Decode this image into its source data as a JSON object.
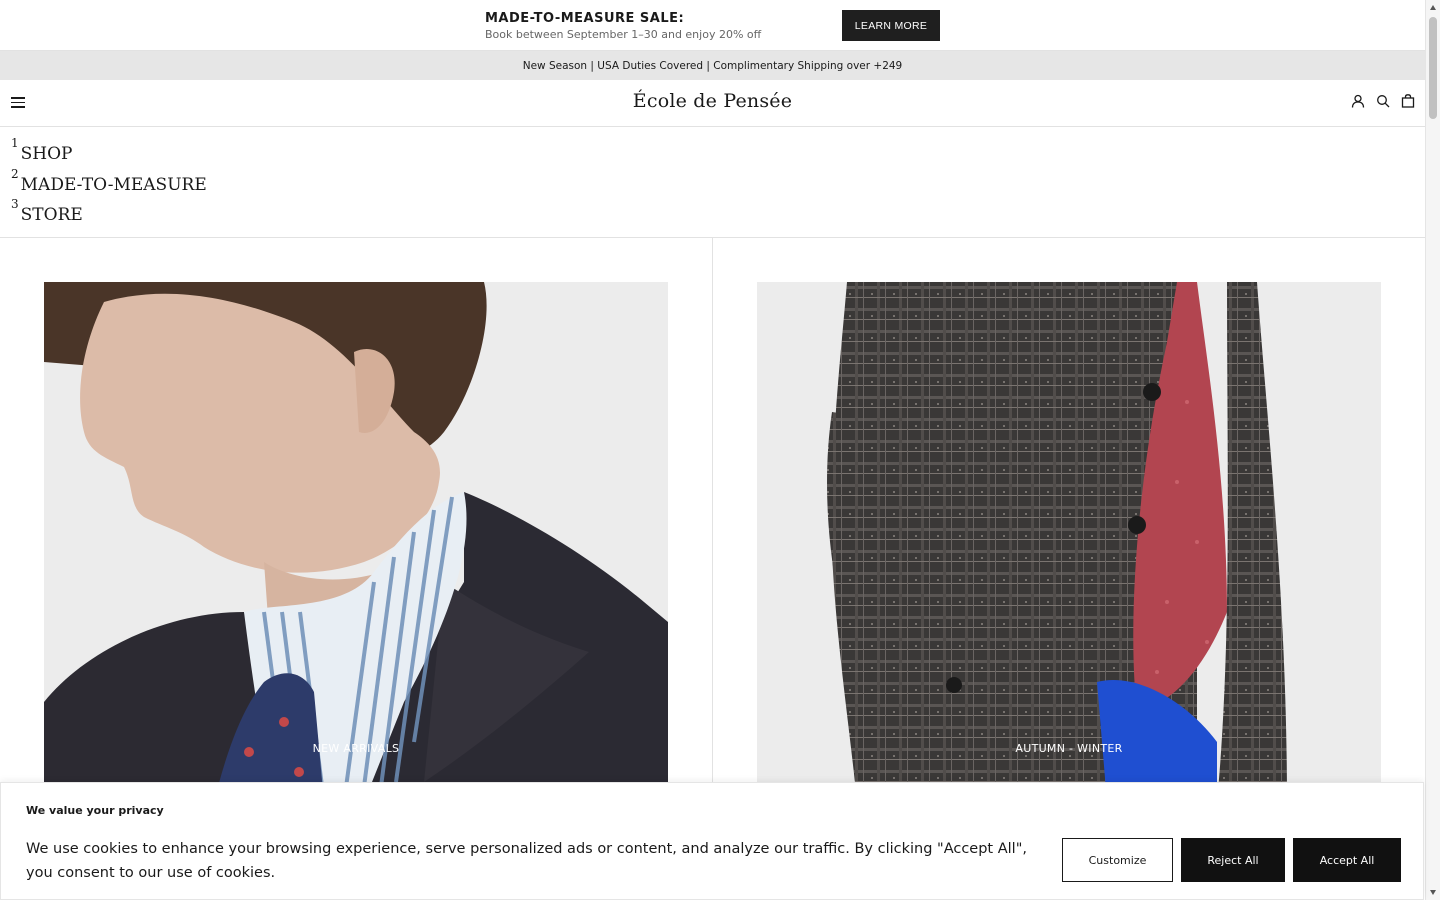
{
  "promo": {
    "title": "MADE-TO-MEASURE SALE:",
    "subtitle": "Book between September 1–30 and enjoy 20% off",
    "button_label": "LEARN MORE"
  },
  "announcement": "New Season | USA Duties Covered | Complimentary Shipping over +249",
  "header": {
    "logo": "École de Pensée",
    "icons": [
      "menu-icon",
      "account-icon",
      "search-icon",
      "bag-icon"
    ]
  },
  "nav": {
    "items": [
      {
        "num": "1",
        "label": "SHOP"
      },
      {
        "num": "2",
        "label": "MADE-TO-MEASURE"
      },
      {
        "num": "3",
        "label": "STORE"
      }
    ]
  },
  "cards": [
    {
      "label": "NEW ARRIVALS"
    },
    {
      "label": "AUTUMN - WINTER"
    }
  ],
  "cookie": {
    "title": "We value your privacy",
    "text": "We use cookies to enhance your browsing experience, serve personalized ads or content, and analyze our traffic. By clicking \"Accept All\", you consent to our use of cookies.",
    "customize": "Customize",
    "reject": "Reject All",
    "accept": "Accept All"
  },
  "colors": {
    "primary": "#1a1a1a",
    "announce_bg": "#e6e6e6",
    "button_dark": "#111111"
  }
}
